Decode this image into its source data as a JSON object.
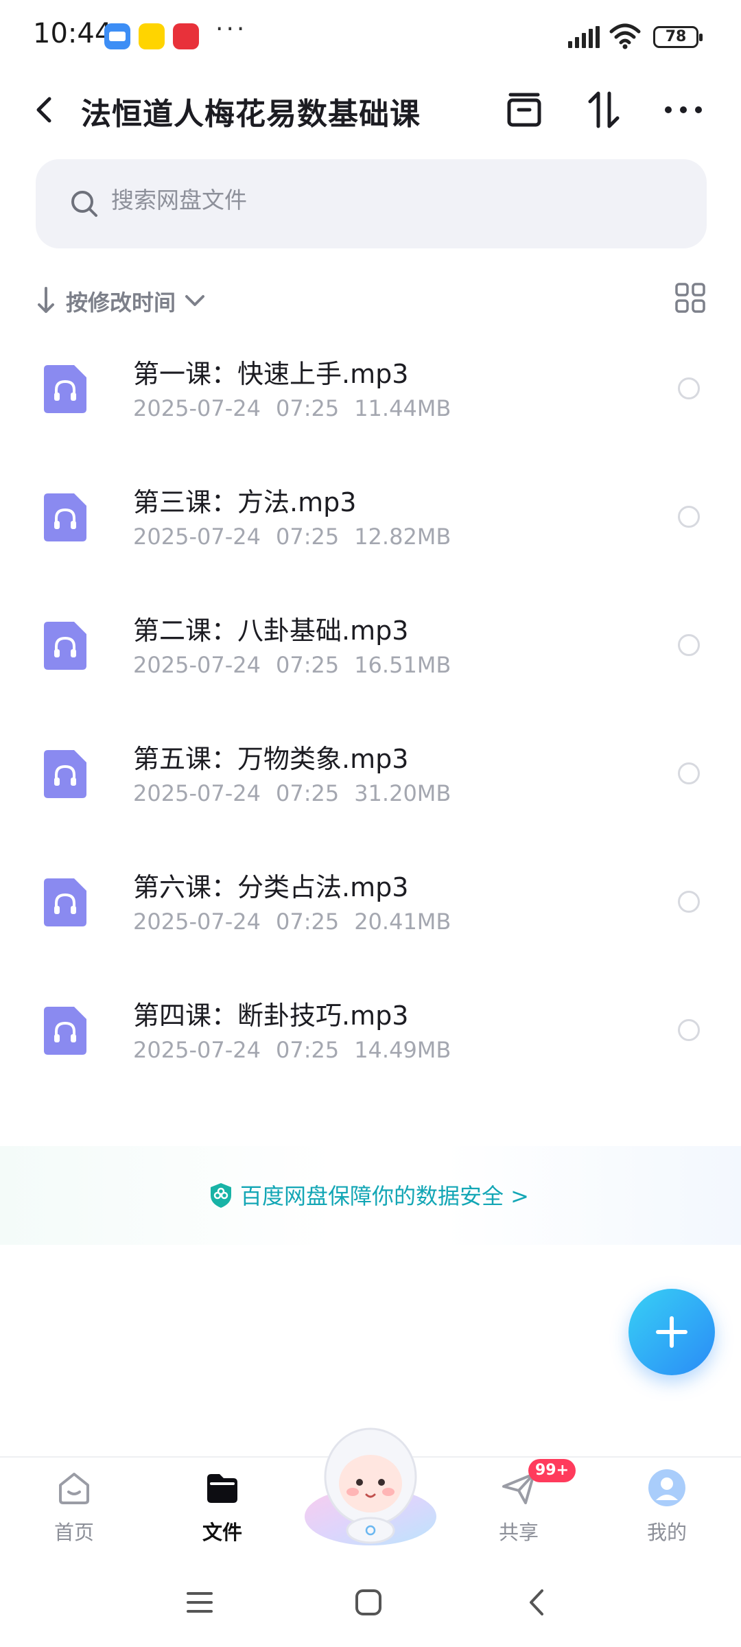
{
  "status_bar": {
    "time": "10:44",
    "dots": "···",
    "battery": "78"
  },
  "header": {
    "title": "法恒道人梅花易数基础课"
  },
  "search": {
    "placeholder": "搜索网盘文件"
  },
  "sort": {
    "label": "按修改时间"
  },
  "files": [
    {
      "name": "第一课：快速上手.mp3",
      "date": "2025-07-24",
      "time": "07:25",
      "size": "11.44MB"
    },
    {
      "name": "第三课：方法.mp3",
      "date": "2025-07-24",
      "time": "07:25",
      "size": "12.82MB"
    },
    {
      "name": "第二课：八卦基础.mp3",
      "date": "2025-07-24",
      "time": "07:25",
      "size": "16.51MB"
    },
    {
      "name": "第五课：万物类象.mp3",
      "date": "2025-07-24",
      "time": "07:25",
      "size": "31.20MB"
    },
    {
      "name": "第六课：分类占法.mp3",
      "date": "2025-07-24",
      "time": "07:25",
      "size": "20.41MB"
    },
    {
      "name": "第四课：断卦技巧.mp3",
      "date": "2025-07-24",
      "time": "07:25",
      "size": "14.49MB"
    }
  ],
  "security_banner": {
    "text": "百度网盘保障你的数据安全 >"
  },
  "bottom_nav": {
    "home": "首页",
    "files": "文件",
    "share": "共享",
    "share_badge": "99+",
    "mine": "我的"
  },
  "colors": {
    "audio_icon": "#8a8af0",
    "accent_teal": "#13a6b5",
    "fab_blue": "#2a8bf6",
    "badge_red": "#ff3b5c"
  },
  "icons": [
    "back-icon",
    "archive-icon",
    "sort-icon",
    "more-icon",
    "search-icon",
    "grid-view-icon",
    "audio-file-icon",
    "shield-icon",
    "plus-icon",
    "home-icon",
    "folder-icon",
    "share-icon",
    "avatar-icon"
  ]
}
